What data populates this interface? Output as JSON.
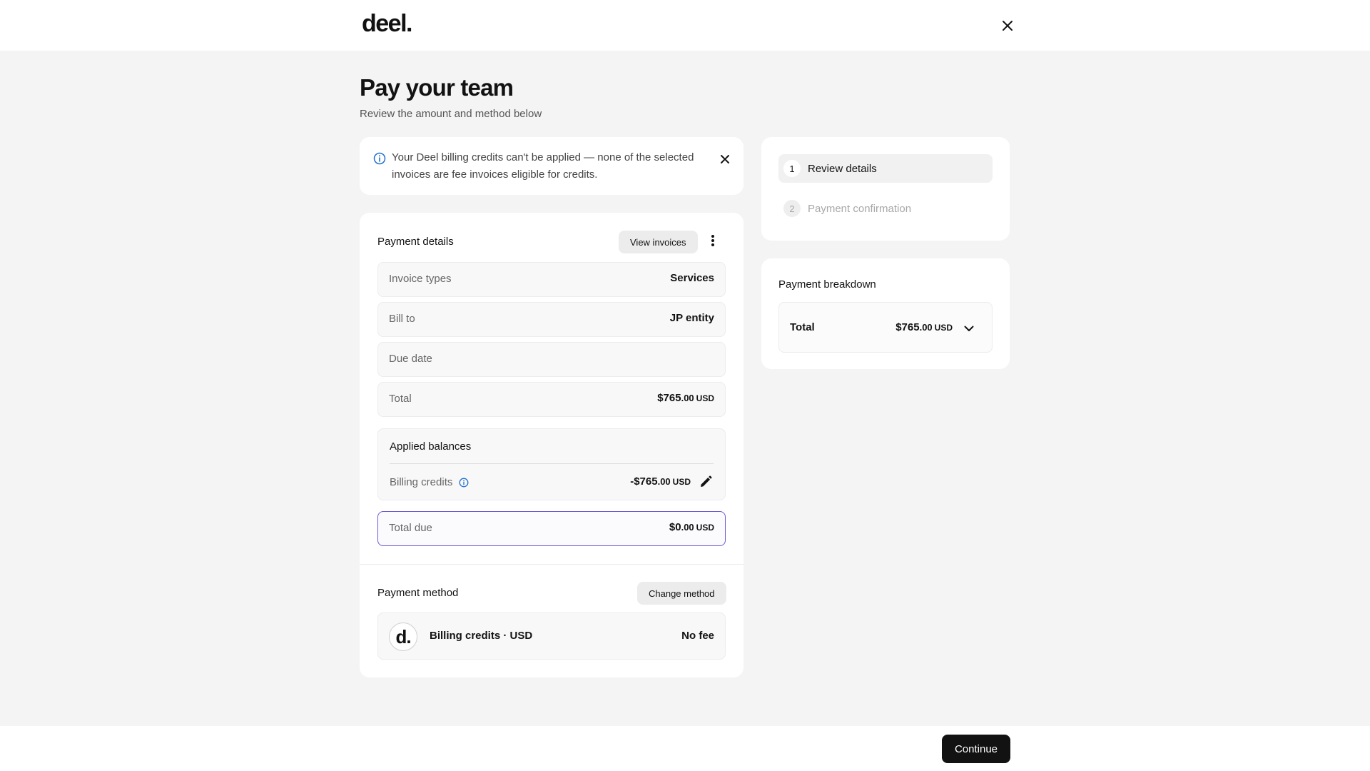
{
  "header": {
    "logo": "deel."
  },
  "page": {
    "title": "Pay your team",
    "subtitle": "Review the amount and method below"
  },
  "alert": {
    "message": "Your Deel billing credits can't be applied — none of the selected invoices are fee invoices eligible for credits."
  },
  "payment_details": {
    "title": "Payment details",
    "view_invoices_label": "View invoices",
    "rows": [
      {
        "label": "Invoice types",
        "value": "Services"
      },
      {
        "label": "Bill to",
        "value": "JP entity"
      },
      {
        "label": "Due date",
        "value": ""
      }
    ],
    "total": {
      "label": "Total",
      "dollars": "$765",
      "cents": ".00",
      "currency": "USD"
    },
    "applied_balances": {
      "title": "Applied balances",
      "billing_credits_label": "Billing credits",
      "dollars": "-$765",
      "cents": ".00",
      "currency": "USD"
    },
    "total_due": {
      "label": "Total due",
      "dollars": "$0",
      "cents": ".00",
      "currency": "USD"
    }
  },
  "payment_method": {
    "title": "Payment method",
    "change_label": "Change method",
    "logo_text": "d.",
    "name": "Billing credits · USD",
    "fee": "No fee"
  },
  "steps": [
    {
      "num": "1",
      "label": "Review details",
      "state": "active"
    },
    {
      "num": "2",
      "label": "Payment confirmation",
      "state": "inactive"
    }
  ],
  "breakdown": {
    "title": "Payment breakdown",
    "total_label": "Total",
    "dollars": "$765",
    "cents": ".00",
    "currency": "USD"
  },
  "footer": {
    "continue_label": "Continue"
  },
  "colors": {
    "accent_border": "#6b5bd6",
    "info_blue": "#1f6fd1",
    "primary_button": "#121212"
  },
  "icons": [
    "close-icon",
    "info-icon",
    "kebab-menu-icon",
    "pencil-icon",
    "chevron-down-icon",
    "deel-logo-icon"
  ]
}
